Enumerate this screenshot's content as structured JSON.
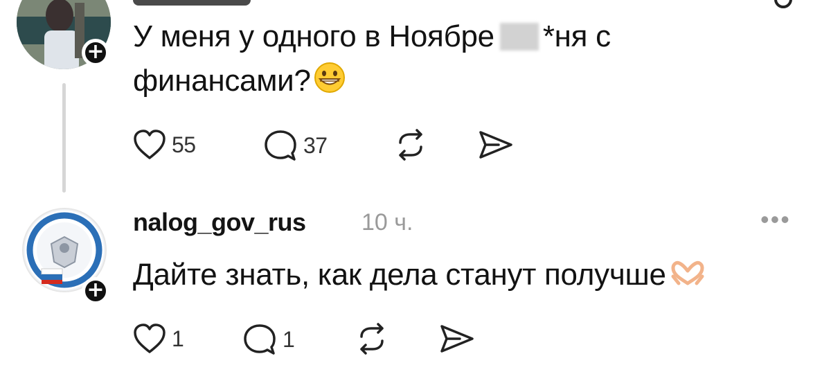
{
  "post1": {
    "text_line1_before": "У меня у одного в Ноябре",
    "text_line1_after": "*ня с",
    "text_line2": "финансами?",
    "likes": "55",
    "comments": "37"
  },
  "post2": {
    "username": "nalog_gov_rus",
    "time": "10 ч.",
    "text": "Дайте знать, как дела станут получше",
    "likes": "1",
    "comments": "1",
    "more": "•••"
  },
  "icons": {
    "like": "heart-icon",
    "comment": "comment-bubble-icon",
    "repost": "repost-icon",
    "share": "send-icon",
    "emoji1": "grinning-face-emoji",
    "emoji2": "heart-hands-emoji"
  }
}
